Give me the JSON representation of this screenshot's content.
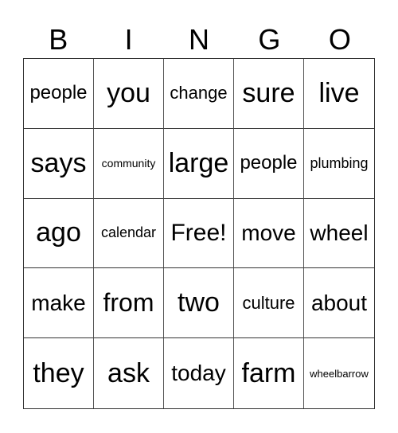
{
  "header": [
    "B",
    "I",
    "N",
    "G",
    "O"
  ],
  "cells": [
    {
      "text": "people",
      "size": 24
    },
    {
      "text": "you",
      "size": 34
    },
    {
      "text": "change",
      "size": 22
    },
    {
      "text": "sure",
      "size": 34
    },
    {
      "text": "live",
      "size": 34
    },
    {
      "text": "says",
      "size": 34
    },
    {
      "text": "community",
      "size": 14
    },
    {
      "text": "large",
      "size": 34
    },
    {
      "text": "people",
      "size": 24
    },
    {
      "text": "plumbing",
      "size": 18
    },
    {
      "text": "ago",
      "size": 34
    },
    {
      "text": "calendar",
      "size": 18
    },
    {
      "text": "Free!",
      "size": 30
    },
    {
      "text": "move",
      "size": 28
    },
    {
      "text": "wheel",
      "size": 28
    },
    {
      "text": "make",
      "size": 28
    },
    {
      "text": "from",
      "size": 32
    },
    {
      "text": "two",
      "size": 34
    },
    {
      "text": "culture",
      "size": 22
    },
    {
      "text": "about",
      "size": 28
    },
    {
      "text": "they",
      "size": 34
    },
    {
      "text": "ask",
      "size": 34
    },
    {
      "text": "today",
      "size": 28
    },
    {
      "text": "farm",
      "size": 34
    },
    {
      "text": "wheelbarrow",
      "size": 13
    }
  ]
}
